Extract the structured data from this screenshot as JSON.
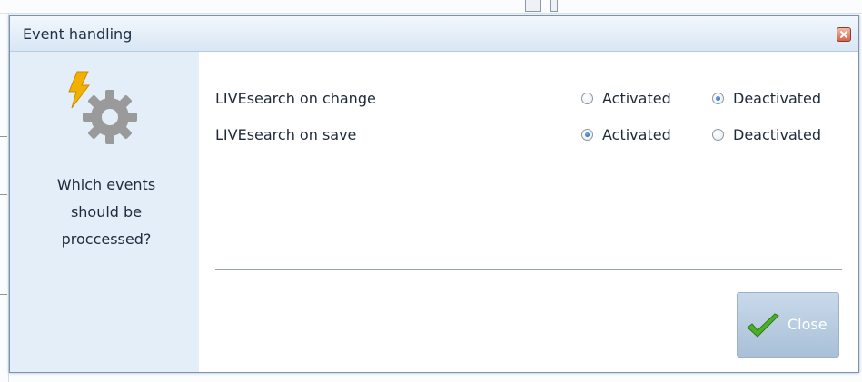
{
  "dialog": {
    "title": "Event handling",
    "close_icon": "close-icon"
  },
  "left_pane": {
    "icon": "lightning-gear-icon",
    "caption_lines": [
      "Which events",
      "should be",
      "proccessed?"
    ]
  },
  "options": [
    {
      "label": "LIVEsearch on change",
      "choices": [
        "Activated",
        "Deactivated"
      ],
      "selected": "Deactivated"
    },
    {
      "label": "LIVEsearch on save",
      "choices": [
        "Activated",
        "Deactivated"
      ],
      "selected": "Activated"
    }
  ],
  "buttons": {
    "close_label": "Close",
    "close_icon": "checkmark-icon"
  },
  "colors": {
    "title_bar": "#d9e6f4",
    "left_pane": "#e4eef9",
    "button": "#b5c9de",
    "check": "#4caf2a",
    "lightning": "#f2b100",
    "gear": "#9a9a9a"
  }
}
